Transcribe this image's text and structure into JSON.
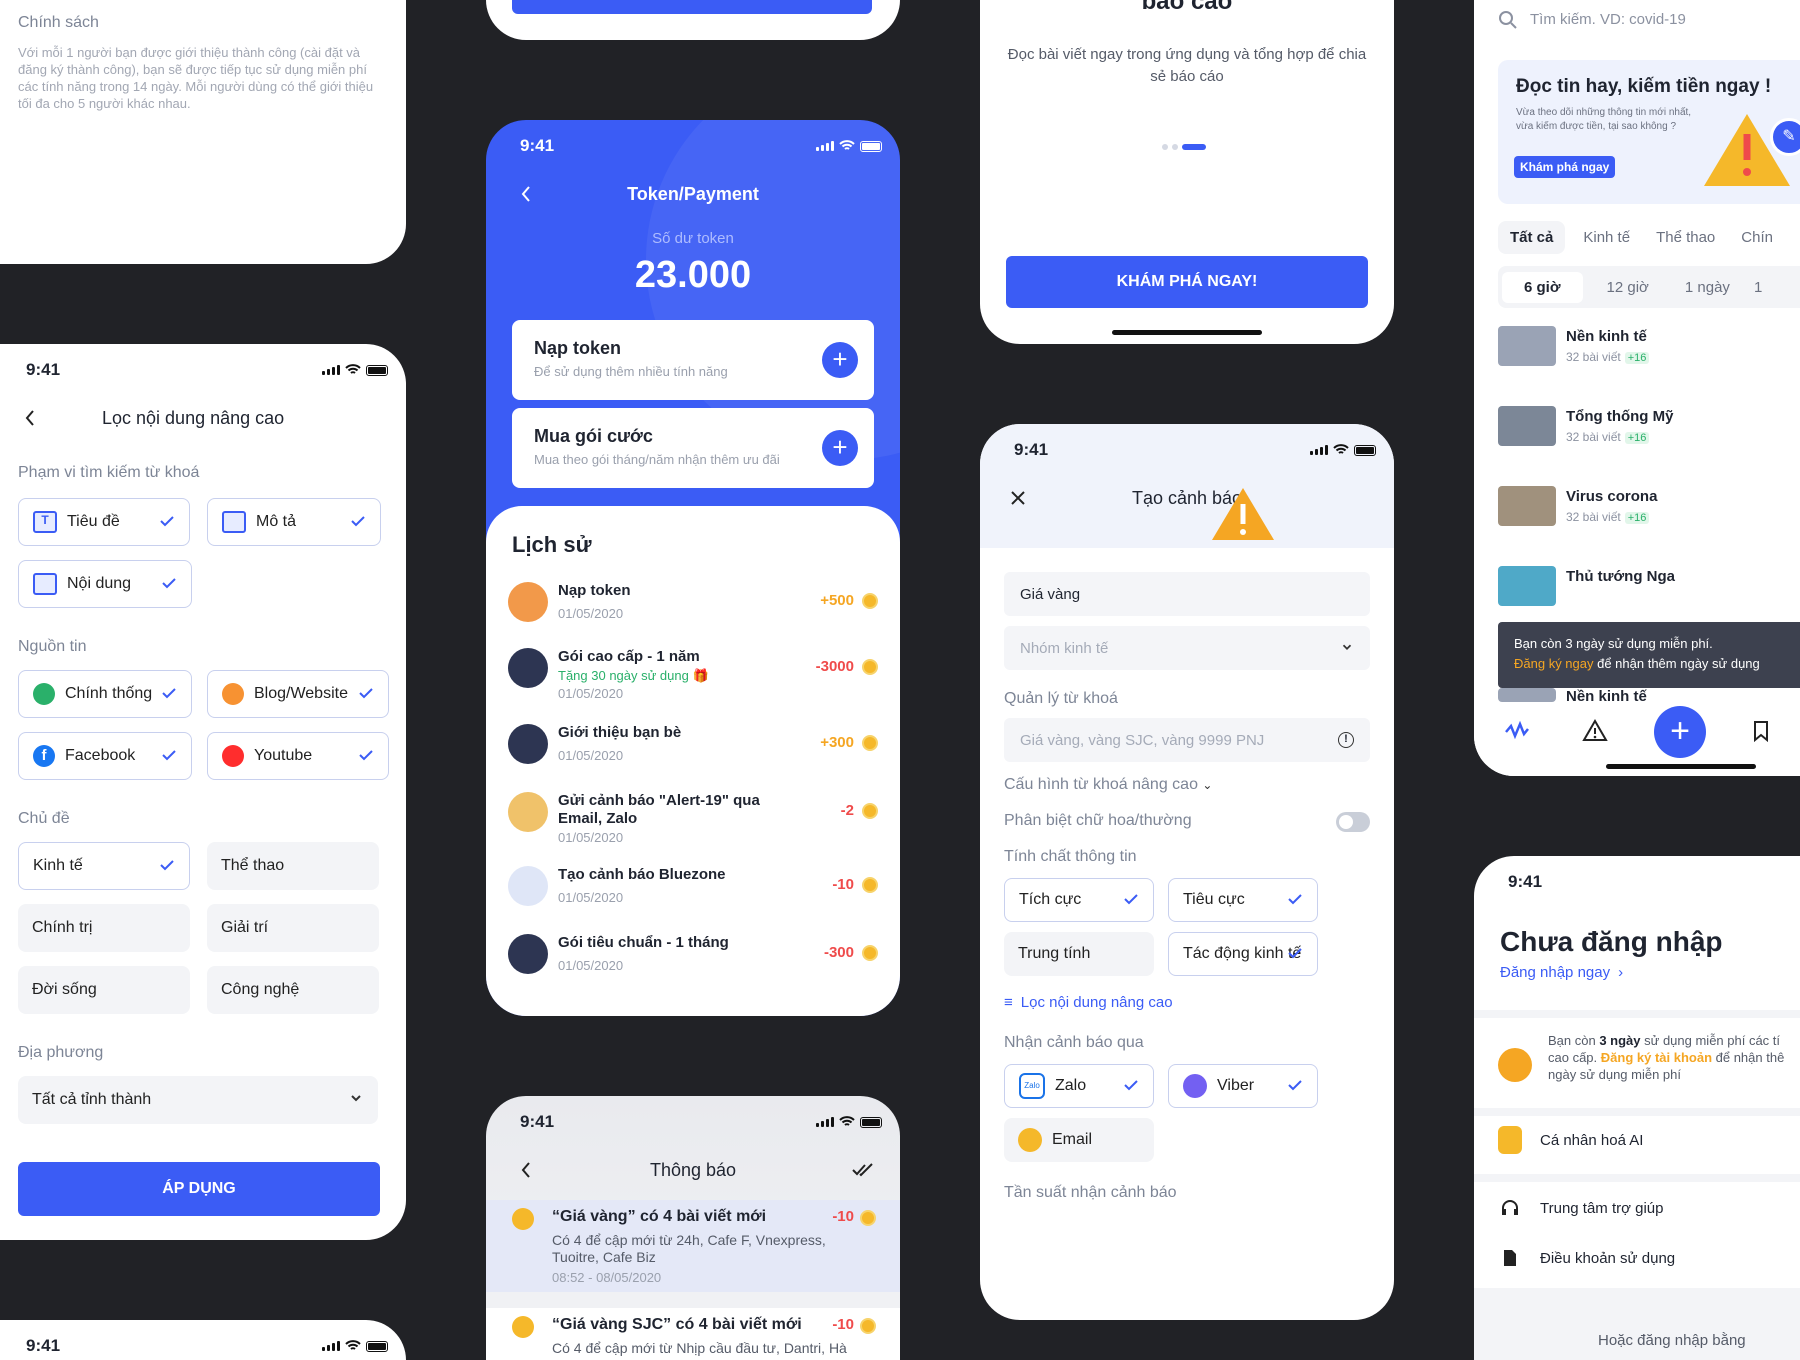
{
  "policy": {
    "title": "Chính sách",
    "body": "Với mỗi 1 người bạn được giới thiệu thành công (cài đặt và đăng ký thành công), bạn sẽ được tiếp tục sử dụng miễn phí các tính năng trong 14 ngày. Mỗi người dùng có thể giới thiệu tối đa cho 5 người khác nhau."
  },
  "filter": {
    "time": "9:41",
    "title": "Lọc nội dung nâng cao",
    "scope_label": "Phạm vi tìm kiếm từ khoá",
    "scope": [
      "Tiêu đề",
      "Mô tả",
      "Nội dung"
    ],
    "source_label": "Nguồn tin",
    "sources": [
      "Chính thống",
      "Blog/Website",
      "Facebook",
      "Youtube"
    ],
    "topic_label": "Chủ đề",
    "topics": [
      "Kinh tế",
      "Thể thao",
      "Chính trị",
      "Giải trí",
      "Đời sống",
      "Công nghệ"
    ],
    "region_label": "Địa phương",
    "region_value": "Tất cả tỉnh thành",
    "apply": "ÁP DỤNG"
  },
  "token": {
    "time": "9:41",
    "title": "Token/Payment",
    "balance_label": "Số dư token",
    "balance": "23.000",
    "topup_title": "Nạp token",
    "topup_sub": "Để sử dụng thêm nhiều tính năng",
    "package_title": "Mua gói cước",
    "package_sub": "Mua theo gói tháng/năm nhận thêm ưu đãi",
    "history_title": "Lịch sử",
    "history": [
      {
        "title": "Nạp token",
        "date": "01/05/2020",
        "value": "+500",
        "color": "#f5a623"
      },
      {
        "title": "Gói cao cấp - 1 năm",
        "extra": "Tặng 30 ngày sử dụng 🎁",
        "date": "01/05/2020",
        "value": "-3000",
        "color": "#ef4b4b"
      },
      {
        "title": "Giới thiệu bạn bè",
        "date": "01/05/2020",
        "value": "+300",
        "color": "#f5a623"
      },
      {
        "title": "Gửi cảnh báo \"Alert-19\" qua",
        "title2": "Email, Zalo",
        "date": "01/05/2020",
        "value": "-2",
        "color": "#ef4b4b"
      },
      {
        "title": "Tạo cảnh báo Bluezone",
        "date": "01/05/2020",
        "value": "-10",
        "color": "#ef4b4b"
      },
      {
        "title": "Gói tiêu chuẩn - 1 tháng",
        "date": "01/05/2020",
        "value": "-300",
        "color": "#ef4b4b"
      }
    ]
  },
  "notif": {
    "time": "9:41",
    "title": "Thông báo",
    "items": [
      {
        "title": "“Giá vàng” có 4 bài viết mới",
        "value": "-10",
        "body": "Có 4 để cập mới từ 24h, Cafe F,  Vnexpress, Tuoitre, Cafe Biz",
        "date": "08:52 - 08/05/2020"
      },
      {
        "title": "“Giá vàng SJC” có 4 bài viết mới",
        "value": "-10",
        "body": "Có 4 để cập mới từ Nhịp cầu đầu tư, Dantri, Hà"
      }
    ]
  },
  "onboard": {
    "title": "báo cáo",
    "body": "Đọc bài viết ngay trong ứng dụng và tổng hợp để chia sẻ báo cáo",
    "cta": "KHÁM PHÁ NGAY!"
  },
  "alert": {
    "time": "9:41",
    "title": "Tạo cảnh báo",
    "name_value": "Giá vàng",
    "group_placeholder": "Nhóm kinh tế",
    "kw_label": "Quản lý từ khoá",
    "kw_placeholder": "Giá vàng, vàng SJC, vàng 9999 PNJ",
    "adv_label": "Cấu hình từ khoá nâng cao",
    "case_label": "Phân biệt chữ hoa/thường",
    "nature_label": "Tính chất thông tin",
    "nature": [
      "Tích cực",
      "Tiêu cực",
      "Trung tính",
      "Tác động kinh tế"
    ],
    "filter_link": "Lọc nội dung nâng cao",
    "via_label": "Nhận cảnh báo qua",
    "via": [
      "Zalo",
      "Viber",
      "Email"
    ],
    "freq_label": "Tần suất nhận cảnh báo"
  },
  "news": {
    "search_placeholder": "Tìm kiếm. VD: covid-19",
    "banner_title": "Đọc tin hay, kiếm tiền ngay !",
    "banner_body": "Vừa theo dõi những thông tin mới nhất, vừa kiếm được tiền, tại sao không ?",
    "banner_btn": "Khám phá ngay",
    "tabs": [
      "Tất cả",
      "Kinh tế",
      "Thể thao",
      "Chín"
    ],
    "times": [
      "6 giờ",
      "12 giờ",
      "1 ngày",
      "1"
    ],
    "items": [
      {
        "title": "Nền kinh tế",
        "sub": "32 bài viết",
        "plus": "+16"
      },
      {
        "title": "Tổng thống Mỹ",
        "sub": "32 bài viết",
        "plus": "+16"
      },
      {
        "title": "Virus corona",
        "sub": "32 bài viết",
        "plus": "+16"
      },
      {
        "title": "Thủ tướng Nga"
      },
      {
        "title": "Nền kinh tế"
      }
    ],
    "toast1": "Bạn còn 3 ngày sử dụng miễn phí.",
    "toast2a": "Đăng ký ngay",
    "toast2b": " để nhận thêm ngày sử dụng"
  },
  "profile": {
    "time": "9:41",
    "title": "Chưa đăng nhập",
    "login": "Đăng nhập ngay",
    "trial_a": "Bạn còn ",
    "trial_b": "3 ngày",
    "trial_c": " sử dụng miễn phí các tí",
    "trial_d": "cao cấp. ",
    "trial_e": "Đăng ký tài khoản",
    "trial_f": " để nhận thê",
    "trial_g": "ngày sử dụng miễn phí",
    "menu": [
      "Cá nhân hoá AI",
      "Trung tâm trợ giúp",
      "Điều khoản sử dụng"
    ],
    "other": "Hoặc đăng nhập bằng"
  },
  "bottom_time": "9:41"
}
